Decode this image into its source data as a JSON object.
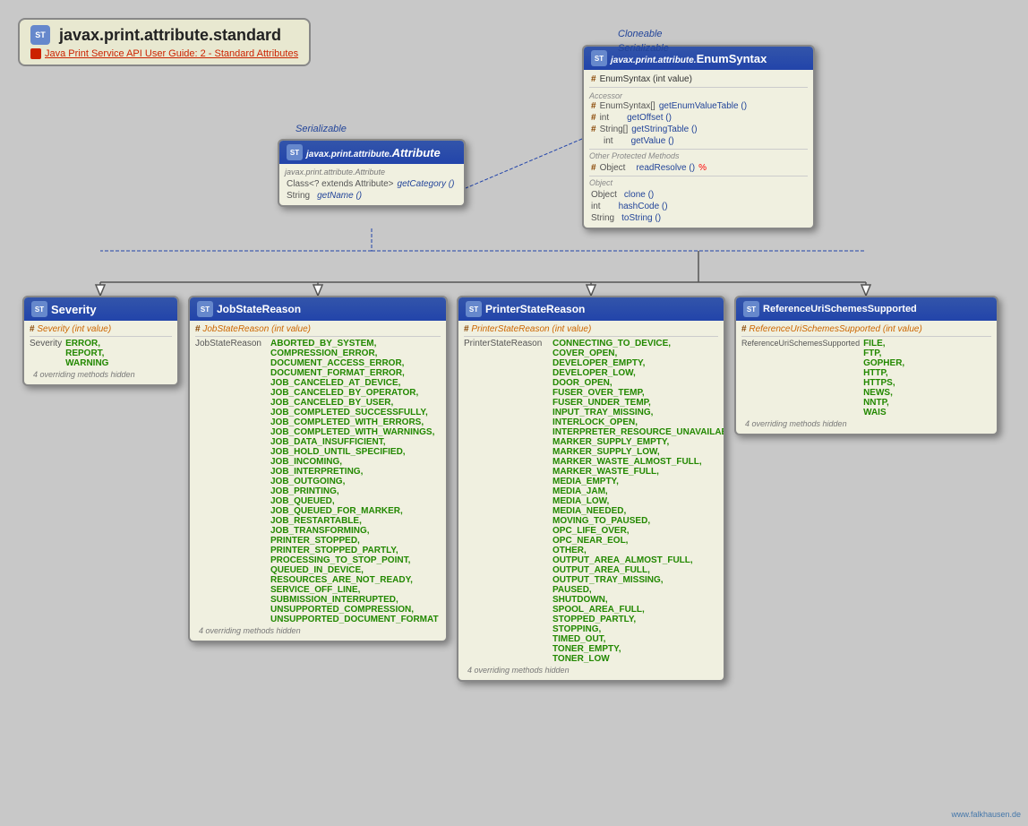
{
  "title": {
    "package": "javax.print.attribute.standard",
    "link_text": "Java Print Service API User Guide: 2 - Standard Attributes"
  },
  "labels": {
    "cloneable": "Cloneable",
    "serializable": "Serializable",
    "serializable_attr": "Serializable",
    "watermark": "www.falkhausen.de"
  },
  "enum_syntax": {
    "package": "javax.print.attribute.",
    "class_name": "EnumSyntax",
    "constructor": "# EnumSyntax (int value)",
    "accessor_label": "Accessor",
    "methods": [
      {
        "hash": "#",
        "type": "EnumSyntax[]",
        "name": "getEnumValueTable ()"
      },
      {
        "hash": "#",
        "type": "int",
        "name": "getOffset ()"
      },
      {
        "hash": "#",
        "type": "String[]",
        "name": "getStringTable ()"
      },
      {
        "hash": "",
        "type": "int",
        "name": "getValue ()"
      }
    ],
    "other_protected_label": "Other Protected Methods",
    "protected_methods": [
      {
        "hash": "#",
        "type": "Object",
        "name": "readResolve ()",
        "red": "%"
      }
    ],
    "object_label": "Object",
    "object_methods": [
      {
        "type": "Object",
        "name": "clone ()"
      },
      {
        "type": "int",
        "name": "hashCode ()"
      },
      {
        "type": "String",
        "name": "toString ()"
      }
    ]
  },
  "attribute": {
    "package": "javax.print.attribute.",
    "class_name": "Attribute",
    "interface_label": "javax.print.attribute.Attribute",
    "methods": [
      {
        "type": "Class<? extends Attribute>",
        "name": "getCategory ()"
      },
      {
        "type": "String",
        "name": "getName ()"
      }
    ]
  },
  "severity": {
    "class_name": "Severity",
    "constructor_row": "# Severity (int value)",
    "constants_type": "Severity",
    "constants": [
      "ERROR,",
      "REPORT,",
      "WARNING"
    ],
    "hidden": "4 overriding methods hidden"
  },
  "job_state_reason": {
    "class_name": "JobStateReason",
    "constructor_row": "# JobStateReason (int value)",
    "constants_type": "JobStateReason",
    "constants": [
      "ABORTED_BY_SYSTEM,",
      "COMPRESSION_ERROR,",
      "DOCUMENT_ACCESS_ERROR,",
      "DOCUMENT_FORMAT_ERROR,",
      "JOB_CANCELED_AT_DEVICE,",
      "JOB_CANCELED_BY_OPERATOR,",
      "JOB_CANCELED_BY_USER,",
      "JOB_COMPLETED_SUCCESSFULLY,",
      "JOB_COMPLETED_WITH_ERRORS,",
      "JOB_COMPLETED_WITH_WARNINGS,",
      "JOB_DATA_INSUFFICIENT,",
      "JOB_HOLD_UNTIL_SPECIFIED,",
      "JOB_INCOMING,",
      "JOB_INTERPRETING,",
      "JOB_OUTGOING,",
      "JOB_PRINTING,",
      "JOB_QUEUED,",
      "JOB_QUEUED_FOR_MARKER,",
      "JOB_RESTARTABLE,",
      "JOB_TRANSFORMING,",
      "PRINTER_STOPPED,",
      "PRINTER_STOPPED_PARTLY,",
      "PROCESSING_TO_STOP_POINT,",
      "QUEUED_IN_DEVICE,",
      "RESOURCES_ARE_NOT_READY,",
      "SERVICE_OFF_LINE,",
      "SUBMISSION_INTERRUPTED,",
      "UNSUPPORTED_COMPRESSION,",
      "UNSUPPORTED_DOCUMENT_FORMAT"
    ],
    "hidden": "4 overriding methods hidden"
  },
  "printer_state_reason": {
    "class_name": "PrinterStateReason",
    "constructor_row": "# PrinterStateReason (int value)",
    "constants_type": "PrinterStateReason",
    "constants": [
      "CONNECTING_TO_DEVICE,",
      "COVER_OPEN,",
      "DEVELOPER_EMPTY,",
      "DEVELOPER_LOW,",
      "DOOR_OPEN,",
      "FUSER_OVER_TEMP,",
      "FUSER_UNDER_TEMP,",
      "INPUT_TRAY_MISSING,",
      "INTERLOCK_OPEN,",
      "INTERPRETER_RESOURCE_UNAVAILABLE,",
      "MARKER_SUPPLY_EMPTY,",
      "MARKER_SUPPLY_LOW,",
      "MARKER_WASTE_ALMOST_FULL,",
      "MARKER_WASTE_FULL,",
      "MEDIA_EMPTY,",
      "MEDIA_JAM,",
      "MEDIA_LOW,",
      "MEDIA_NEEDED,",
      "MOVING_TO_PAUSED,",
      "OPC_LIFE_OVER,",
      "OPC_NEAR_EOL,",
      "OTHER,",
      "OUTPUT_AREA_ALMOST_FULL,",
      "OUTPUT_AREA_FULL,",
      "OUTPUT_TRAY_MISSING,",
      "PAUSED,",
      "SHUTDOWN,",
      "SPOOL_AREA_FULL,",
      "STOPPED_PARTLY,",
      "STOPPING,",
      "TIMED_OUT,",
      "TONER_EMPTY,",
      "TONER_LOW"
    ],
    "hidden": "4 overriding methods hidden"
  },
  "reference_uri": {
    "class_name": "ReferenceUriSchemesSupported",
    "constructor_row": "# ReferenceUriSchemesSupported (int value)",
    "constants_type": "ReferenceUriSchemesSupported",
    "constants": [
      "FILE,",
      "FTP,",
      "GOPHER,",
      "HTTP,",
      "HTTPS,",
      "NEWS,",
      "NNTP,",
      "WAIS"
    ],
    "hidden": "4 overriding methods hidden"
  }
}
